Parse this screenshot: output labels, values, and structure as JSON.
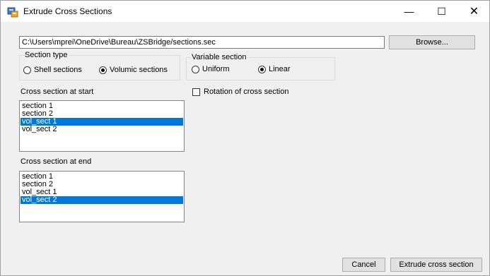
{
  "window": {
    "title": "Extrude Cross Sections",
    "minimize": "—",
    "maximize": "☐",
    "close": "✕"
  },
  "file": {
    "path": "C:\\Users\\mprei\\OneDrive\\Bureau\\ZSBridge/sections.sec",
    "browse_label": "Browse..."
  },
  "section_type": {
    "legend": "Section type",
    "options": [
      {
        "label": "Shell sections",
        "checked": false
      },
      {
        "label": "Volumic sections",
        "checked": true
      }
    ]
  },
  "variable_section": {
    "legend": "Variable section",
    "options": [
      {
        "label": "Uniform",
        "checked": false
      },
      {
        "label": "Linear",
        "checked": true
      }
    ]
  },
  "rotation": {
    "label": "Rotation of cross section",
    "checked": false
  },
  "start": {
    "label": "Cross section at start",
    "items": [
      "section 1",
      "section 2",
      "vol_sect 1",
      "vol_sect 2"
    ],
    "selected_index": 2
  },
  "end": {
    "label": "Cross section at end",
    "items": [
      "section 1",
      "section 2",
      "vol_sect 1",
      "vol_sect 2"
    ],
    "selected_index": 3
  },
  "actions": {
    "cancel_label": "Cancel",
    "extrude_label": "Extrude cross section"
  },
  "colors": {
    "selection": "#0078d7",
    "background": "#f0f0f0"
  }
}
